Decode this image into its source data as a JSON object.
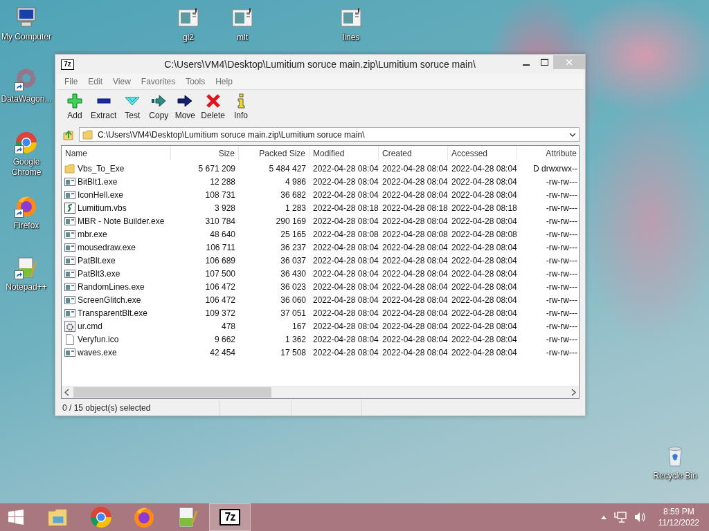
{
  "desktop": {
    "left_icons": [
      {
        "label": "My Computer",
        "kind": "computer",
        "shortcut": false
      },
      {
        "label": "DataWagon...",
        "kind": "dots",
        "shortcut": true
      },
      {
        "label": "Google Chrome",
        "kind": "chrome",
        "shortcut": true
      },
      {
        "label": "Firefox",
        "kind": "firefox",
        "shortcut": true
      },
      {
        "label": "Notepad++",
        "kind": "notepad",
        "shortcut": true
      }
    ],
    "top_icons": [
      {
        "label": "gl2",
        "kind": "app",
        "shortcut": false
      },
      {
        "label": "mlt",
        "kind": "app",
        "shortcut": false
      },
      {
        "label": "lines",
        "kind": "app",
        "shortcut": false
      }
    ],
    "corner_icons": [
      {
        "label": "Recycle Bin",
        "kind": "recycle",
        "shortcut": false
      }
    ]
  },
  "window": {
    "logo": "7z",
    "title": "C:\\Users\\VM4\\Desktop\\Lumitium soruce main.zip\\Lumitium soruce main\\",
    "menu": [
      "File",
      "Edit",
      "View",
      "Favorites",
      "Tools",
      "Help"
    ],
    "toolbar": [
      {
        "label": "Add",
        "kind": "add"
      },
      {
        "label": "Extract",
        "kind": "extract"
      },
      {
        "label": "Test",
        "kind": "test"
      },
      {
        "label": "Copy",
        "kind": "copy"
      },
      {
        "label": "Move",
        "kind": "move"
      },
      {
        "label": "Delete",
        "kind": "delete"
      },
      {
        "label": "Info",
        "kind": "info"
      }
    ],
    "address": "C:\\Users\\VM4\\Desktop\\Lumitium soruce main.zip\\Lumitium soruce main\\",
    "columns": [
      "Name",
      "Size",
      "Packed Size",
      "Modified",
      "Created",
      "Accessed",
      "Attribute"
    ],
    "rows": [
      {
        "kind": "folder",
        "cells": [
          "Vbs_To_Exe",
          "5 671 209",
          "5 484 427",
          "2022-04-28 08:04",
          "2022-04-28 08:04",
          "2022-04-28 08:04",
          "D drwxrwx--"
        ]
      },
      {
        "kind": "exe",
        "cells": [
          "BitBlt1.exe",
          "12 288",
          "4 986",
          "2022-04-28 08:04",
          "2022-04-28 08:04",
          "2022-04-28 08:04",
          "-rw-rw---"
        ]
      },
      {
        "kind": "exe",
        "cells": [
          "IconHell.exe",
          "108 731",
          "36 682",
          "2022-04-28 08:04",
          "2022-04-28 08:04",
          "2022-04-28 08:04",
          "-rw-rw---"
        ]
      },
      {
        "kind": "script",
        "cells": [
          "Lumitium.vbs",
          "3 928",
          "1 283",
          "2022-04-28 08:18",
          "2022-04-28 08:18",
          "2022-04-28 08:18",
          "-rw-rw---"
        ]
      },
      {
        "kind": "exe",
        "cells": [
          "MBR - Note Builder.exe",
          "310 784",
          "290 169",
          "2022-04-28 08:04",
          "2022-04-28 08:04",
          "2022-04-28 08:04",
          "-rw-rw---"
        ]
      },
      {
        "kind": "exe",
        "cells": [
          "mbr.exe",
          "48 640",
          "25 165",
          "2022-04-28 08:08",
          "2022-04-28 08:08",
          "2022-04-28 08:08",
          "-rw-rw---"
        ]
      },
      {
        "kind": "exe",
        "cells": [
          "mousedraw.exe",
          "106 711",
          "36 237",
          "2022-04-28 08:04",
          "2022-04-28 08:04",
          "2022-04-28 08:04",
          "-rw-rw---"
        ]
      },
      {
        "kind": "exe",
        "cells": [
          "PatBlt.exe",
          "106 689",
          "36 037",
          "2022-04-28 08:04",
          "2022-04-28 08:04",
          "2022-04-28 08:04",
          "-rw-rw---"
        ]
      },
      {
        "kind": "exe",
        "cells": [
          "PatBlt3.exe",
          "107 500",
          "36 430",
          "2022-04-28 08:04",
          "2022-04-28 08:04",
          "2022-04-28 08:04",
          "-rw-rw---"
        ]
      },
      {
        "kind": "exe",
        "cells": [
          "RandomLines.exe",
          "106 472",
          "36 023",
          "2022-04-28 08:04",
          "2022-04-28 08:04",
          "2022-04-28 08:04",
          "-rw-rw---"
        ]
      },
      {
        "kind": "exe",
        "cells": [
          "ScreenGlitch.exe",
          "106 472",
          "36 060",
          "2022-04-28 08:04",
          "2022-04-28 08:04",
          "2022-04-28 08:04",
          "-rw-rw---"
        ]
      },
      {
        "kind": "exe",
        "cells": [
          "TransparentBlt.exe",
          "109 372",
          "37 051",
          "2022-04-28 08:04",
          "2022-04-28 08:04",
          "2022-04-28 08:04",
          "-rw-rw---"
        ]
      },
      {
        "kind": "cmd",
        "cells": [
          "ur.cmd",
          "478",
          "167",
          "2022-04-28 08:04",
          "2022-04-28 08:04",
          "2022-04-28 08:04",
          "-rw-rw---"
        ]
      },
      {
        "kind": "file",
        "cells": [
          "Veryfun.ico",
          "9 662",
          "1 362",
          "2022-04-28 08:04",
          "2022-04-28 08:04",
          "2022-04-28 08:04",
          "-rw-rw---"
        ]
      },
      {
        "kind": "exe",
        "cells": [
          "waves.exe",
          "42 454",
          "17 508",
          "2022-04-28 08:04",
          "2022-04-28 08:04",
          "2022-04-28 08:04",
          "-rw-rw---"
        ]
      }
    ],
    "status_bar": "0 / 15 object(s) selected"
  },
  "taskbar": {
    "apps": [
      {
        "kind": "explorer",
        "selected": false
      },
      {
        "kind": "chrome",
        "selected": false
      },
      {
        "kind": "firefox",
        "selected": false
      },
      {
        "kind": "notepad",
        "selected": false
      },
      {
        "kind": "sevenzip",
        "label": "7z",
        "selected": true
      }
    ],
    "time": "8:59 PM",
    "date": "11/12/2022"
  }
}
